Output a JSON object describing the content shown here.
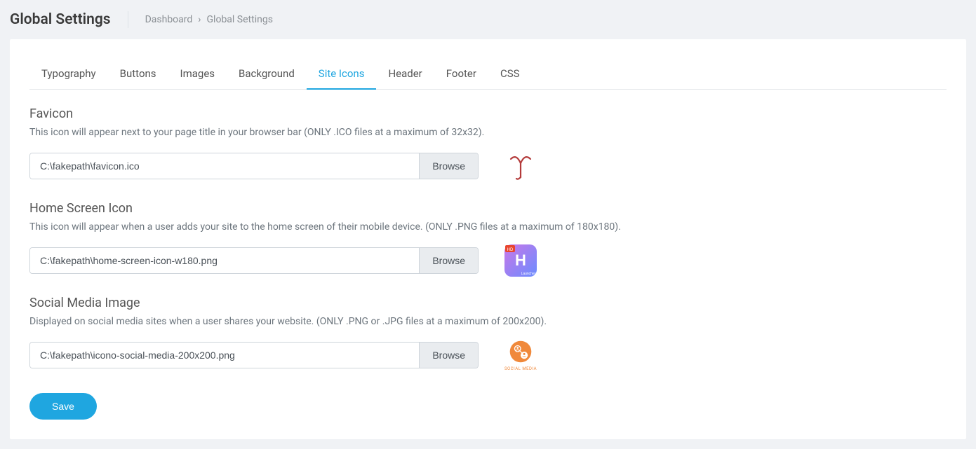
{
  "header": {
    "title": "Global Settings",
    "breadcrumb": [
      "Dashboard",
      "Global Settings"
    ]
  },
  "tabs": [
    {
      "label": "Typography",
      "active": false
    },
    {
      "label": "Buttons",
      "active": false
    },
    {
      "label": "Images",
      "active": false
    },
    {
      "label": "Background",
      "active": false
    },
    {
      "label": "Site Icons",
      "active": true
    },
    {
      "label": "Header",
      "active": false
    },
    {
      "label": "Footer",
      "active": false
    },
    {
      "label": "CSS",
      "active": false
    }
  ],
  "sections": {
    "favicon": {
      "title": "Favicon",
      "desc": "This icon will appear next to your page title in your browser bar (ONLY .ICO files at a maximum of 32x32).",
      "path": "C:\\fakepath\\favicon.ico",
      "browse": "Browse"
    },
    "homescreen": {
      "title": "Home Screen Icon",
      "desc": "This icon will appear when a user adds your site to the home screen of their mobile device. (ONLY .PNG files at a maximum of 180x180).",
      "path": "C:\\fakepath\\home-screen-icon-w180.png",
      "browse": "Browse"
    },
    "social": {
      "title": "Social Media Image",
      "desc": "Displayed on social media sites when a user shares your website. (ONLY .PNG or .JPG files at a maximum of 200x200).",
      "path": "C:\\fakepath\\icono-social-media-200x200.png",
      "browse": "Browse",
      "preview_label": "SOCIAL MEDIA"
    }
  },
  "buttons": {
    "save": "Save"
  }
}
